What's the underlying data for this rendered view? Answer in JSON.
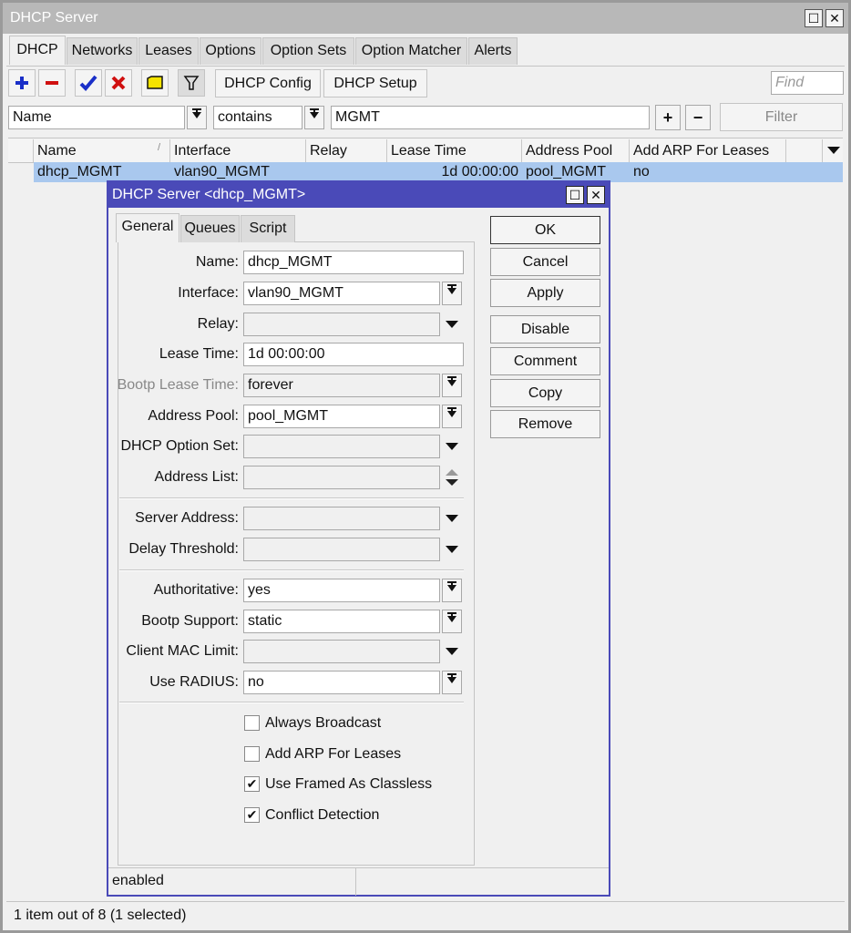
{
  "window": {
    "title": "DHCP Server"
  },
  "tabs": [
    "DHCP",
    "Networks",
    "Leases",
    "Options",
    "Option Sets",
    "Option Matcher",
    "Alerts"
  ],
  "toolbar": {
    "dhcp_config_label": "DHCP Config",
    "dhcp_setup_label": "DHCP Setup",
    "find_placeholder": "Find"
  },
  "filter": {
    "field": "Name",
    "operator": "contains",
    "value": "MGMT",
    "button_label": "Filter"
  },
  "table": {
    "columns": [
      "Name",
      "Interface",
      "Relay",
      "Lease Time",
      "Address Pool",
      "Add ARP For Leases"
    ],
    "rows": [
      {
        "name": "dhcp_MGMT",
        "interface": "vlan90_MGMT",
        "relay": "",
        "lease_time": "1d 00:00:00",
        "address_pool": "pool_MGMT",
        "add_arp": "no"
      }
    ]
  },
  "status": "1 item out of 8 (1 selected)",
  "dialog": {
    "title": "DHCP Server <dhcp_MGMT>",
    "tabs": [
      "General",
      "Queues",
      "Script"
    ],
    "fields": {
      "name": {
        "label": "Name:",
        "value": "dhcp_MGMT"
      },
      "interface": {
        "label": "Interface:",
        "value": "vlan90_MGMT"
      },
      "relay": {
        "label": "Relay:",
        "value": ""
      },
      "lease_time": {
        "label": "Lease Time:",
        "value": "1d 00:00:00"
      },
      "bootp_lease_time": {
        "label": "Bootp Lease Time:",
        "value": "forever"
      },
      "address_pool": {
        "label": "Address Pool:",
        "value": "pool_MGMT"
      },
      "dhcp_option_set": {
        "label": "DHCP Option Set:",
        "value": ""
      },
      "address_list": {
        "label": "Address List:",
        "value": ""
      },
      "server_address": {
        "label": "Server Address:",
        "value": ""
      },
      "delay_threshold": {
        "label": "Delay Threshold:",
        "value": ""
      },
      "authoritative": {
        "label": "Authoritative:",
        "value": "yes"
      },
      "bootp_support": {
        "label": "Bootp Support:",
        "value": "static"
      },
      "client_mac_limit": {
        "label": "Client MAC Limit:",
        "value": ""
      },
      "use_radius": {
        "label": "Use RADIUS:",
        "value": "no"
      }
    },
    "checkboxes": [
      {
        "label": "Always Broadcast",
        "checked": false
      },
      {
        "label": "Add ARP For Leases",
        "checked": false
      },
      {
        "label": "Use Framed As Classless",
        "checked": true
      },
      {
        "label": "Conflict Detection",
        "checked": true
      }
    ],
    "buttons": [
      "OK",
      "Cancel",
      "Apply",
      "Disable",
      "Comment",
      "Copy",
      "Remove"
    ],
    "status": "enabled"
  }
}
